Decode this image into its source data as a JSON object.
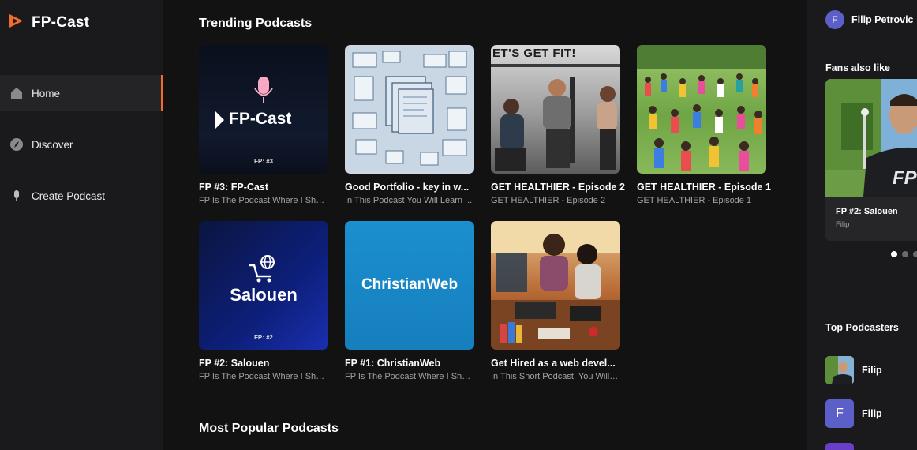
{
  "app": {
    "name": "FP-Cast"
  },
  "sidebar": {
    "items": [
      {
        "label": "Home",
        "icon": "home-icon",
        "active": true
      },
      {
        "label": "Discover",
        "icon": "compass-icon",
        "active": false
      },
      {
        "label": "Create Podcast",
        "icon": "microphone-icon",
        "active": false
      }
    ]
  },
  "main": {
    "trending_title": "Trending Podcasts",
    "popular_title": "Most Popular Podcasts",
    "cards": [
      {
        "title": "FP #3: FP-Cast",
        "subtitle": "FP Is The Podcast Where I Share...",
        "art_text": "FP-Cast",
        "art_badge": "FP: #3"
      },
      {
        "title": "Good Portfolio - key in w...",
        "subtitle": "In This Podcast You Will Learn ...",
        "art_text": "",
        "art_badge": ""
      },
      {
        "title": "GET HEALTHIER - Episode 2",
        "subtitle": "GET HEALTHIER - Episode 2",
        "art_text": "ET'S GET FIT!",
        "art_badge": ""
      },
      {
        "title": "GET HEALTHIER - Episode 1",
        "subtitle": "GET HEALTHIER - Episode 1",
        "art_text": "",
        "art_badge": ""
      },
      {
        "title": "FP #2: Salouen",
        "subtitle": "FP Is The Podcast Where I Share...",
        "art_text": "Salouen",
        "art_badge": "FP: #2"
      },
      {
        "title": "FP #1: ChristianWeb",
        "subtitle": "FP Is The Podcast Where I Share...",
        "art_text": "ChristianWeb",
        "art_badge": ""
      },
      {
        "title": "Get Hired as a web devel...",
        "subtitle": "In This Short Podcast, You Will L...",
        "art_text": "",
        "art_badge": ""
      }
    ]
  },
  "right": {
    "user_name": "Filip Petrovic",
    "user_initial": "F",
    "fans_title": "Fans also like",
    "fan_card": {
      "title": "FP #2: Salouen",
      "subtitle": "Filip",
      "art_text": "FP"
    },
    "top_title": "Top Podcasters",
    "podcasters": [
      {
        "name": "Filip",
        "initial": ""
      },
      {
        "name": "Filip",
        "initial": "F"
      }
    ]
  },
  "colors": {
    "accent": "#f26b2a",
    "avatar": "#5b5fc7",
    "background": "#121212",
    "panel": "#1a1a1c"
  }
}
